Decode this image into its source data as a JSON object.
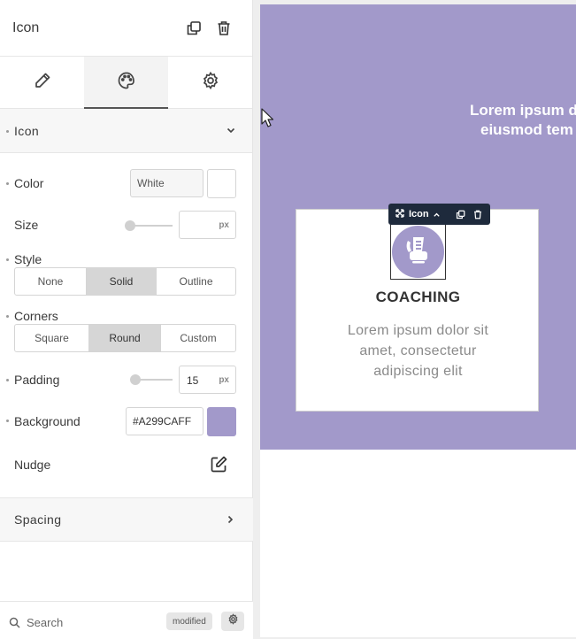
{
  "panel": {
    "title": "Icon",
    "tabs": [
      {
        "name": "content",
        "icon": "pencil-icon"
      },
      {
        "name": "style",
        "icon": "palette-icon"
      },
      {
        "name": "advanced",
        "icon": "gear-icon"
      }
    ],
    "sections": {
      "icon": {
        "label": "Icon"
      },
      "spacing": {
        "label": "Spacing"
      }
    },
    "fields": {
      "color": {
        "label": "Color",
        "value": "White",
        "swatch": "#ffffff"
      },
      "size": {
        "label": "Size",
        "value": "",
        "unit": "px"
      },
      "style": {
        "label": "Style",
        "options": [
          "None",
          "Solid",
          "Outline"
        ],
        "selected": "Solid"
      },
      "corners": {
        "label": "Corners",
        "options": [
          "Square",
          "Round",
          "Custom"
        ],
        "selected": "Round"
      },
      "padding": {
        "label": "Padding",
        "value": "15",
        "unit": "px"
      },
      "background": {
        "label": "Background",
        "value": "#A299CAFF",
        "swatch": "#a299ca"
      },
      "nudge": {
        "label": "Nudge"
      }
    },
    "bottom": {
      "search_placeholder": "Search",
      "badge": "modified"
    }
  },
  "canvas": {
    "hero_color": "#a299ca",
    "hero_lines": [
      "Lorem ipsum d",
      "eiusmod tem"
    ],
    "toolbar_label": "Icon",
    "card": {
      "title": "COACHING",
      "body_lines": [
        "Lorem ipsum dolor sit",
        "amet, consectetur",
        "adipiscing elit"
      ],
      "icon": "phone-book-icon"
    }
  }
}
